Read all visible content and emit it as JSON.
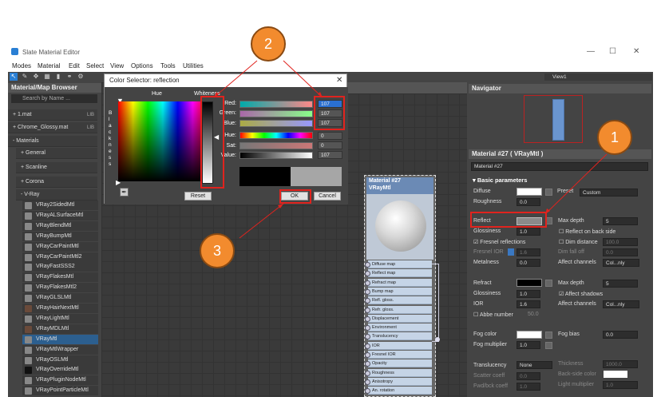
{
  "window": {
    "title": "Slate Material Editor",
    "minimize": "—",
    "maximize": "☐",
    "close": "✕"
  },
  "menu": [
    "Modes",
    "Material",
    "Edit",
    "Select",
    "View",
    "Options",
    "Tools",
    "Utilities"
  ],
  "viewLabel": "View1",
  "browser": {
    "title": "Material/Map Browser",
    "search": "Search by Name ...",
    "items": [
      {
        "label": "+ 1.mat",
        "tag": "LIB"
      },
      {
        "label": "+ Chrome_Glossy.mat",
        "tag": "LIB"
      },
      {
        "label": "- Materials",
        "tag": ""
      },
      {
        "label": "+ General",
        "tag": ""
      },
      {
        "label": "+ Scanline",
        "tag": ""
      },
      {
        "label": "+ Corona",
        "tag": ""
      },
      {
        "label": "- V-Ray",
        "tag": ""
      }
    ],
    "mtls": [
      "VRay2SidedMtl",
      "VRayALSurfaceMtl",
      "VRayBlendMtl",
      "VRayBumpMtl",
      "VRayCarPaintMtl",
      "VRayCarPaintMtl2",
      "VRayFastSSS2",
      "VRayFlakesMtl",
      "VRayFlakesMtl2",
      "VRayGLSLMtl",
      "VRayHairNextMtl",
      "VRayLightMtl",
      "VRayMDLMtl",
      "VRayMtl",
      "VRayMtlWrapper",
      "VRayOSLMtl",
      "VRayOverrideMtl",
      "VRayPluginNodeMtl",
      "VRayPointParticleMtl"
    ]
  },
  "node": {
    "title": "Material #27",
    "subtitle": "VRayMtl",
    "slots": [
      "Diffuse map",
      "Reflect map",
      "Refract map",
      "Bump map",
      "Refl. gloss.",
      "Refr. gloss.",
      "Displacement",
      "Environment",
      "Translucency",
      "IOR",
      "Fresnel IOR",
      "Opacity",
      "Roughness",
      "Anisotropy",
      "An. rotation"
    ]
  },
  "navigator": {
    "title": "Navigator"
  },
  "params": {
    "header": "Material #27  ( VRayMtl )",
    "name": "Material #27",
    "rollout": "Basic parameters",
    "diffuse": "Diffuse",
    "roughness": "Roughness",
    "roughness_val": "0.0",
    "preset": "Preset",
    "preset_val": "Custom",
    "reflect": "Reflect",
    "glossiness": "Glossiness",
    "gloss_val": "1.0",
    "max_depth": "Max depth",
    "max_depth_val": "5",
    "reflect_back": "Reflect on back side",
    "fresnel": "Fresnel reflections",
    "dim_distance": "Dim distance",
    "dim_val": "100.0",
    "fresnel_ior": "Fresnel IOR",
    "fresnel_ior_val": "1.6",
    "dim_falloff": "Dim fall off",
    "dim_falloff_val": "0.0",
    "metalness": "Metalness",
    "metal_val": "0.0",
    "affect_channels": "Affect channels",
    "affect_val": "Col...nly",
    "refract": "Refract",
    "r_max_depth": "Max depth",
    "r_max_val": "5",
    "r_gloss": "Glossiness",
    "r_gloss_val": "1.0",
    "affect_shadows": "Affect shadows",
    "ior": "IOR",
    "ior_val": "1.6",
    "r_affect": "Affect channels",
    "r_affect_val": "Col...nly",
    "abbe": "Abbe number",
    "abbe_val": "50.0",
    "fog_color": "Fog color",
    "fog_bias": "Fog bias",
    "fog_bias_val": "0.0",
    "fog_mult": "Fog multiplier",
    "fog_mult_val": "1.0",
    "translucency": "Translucency",
    "trans_val": "None",
    "thickness": "Thickness",
    "thickness_val": "1000.0",
    "scatter": "Scatter coeff",
    "scatter_val": "0.0",
    "backside": "Back-side color",
    "fwd": "Fwd/bck coeff",
    "fwd_val": "1.0",
    "light_mult": "Light multiplier",
    "light_val": "1.0"
  },
  "dialog": {
    "title": "Color Selector: reflection",
    "hue": "Hue",
    "whiteness": "Whiteness",
    "blackness": "B\nl\na\nc\nk\nn\ne\ns\ns",
    "red": "Red:",
    "green": "Green:",
    "blue": "Blue:",
    "hue_l": "Hue:",
    "sat": "Sat:",
    "value": "Value:",
    "red_v": "107",
    "green_v": "107",
    "blue_v": "107",
    "hue_v": "0",
    "sat_v": "0",
    "val_v": "107",
    "reset": "Reset",
    "ok": "OK",
    "cancel": "Cancel"
  },
  "callouts": [
    "1",
    "2",
    "3"
  ]
}
